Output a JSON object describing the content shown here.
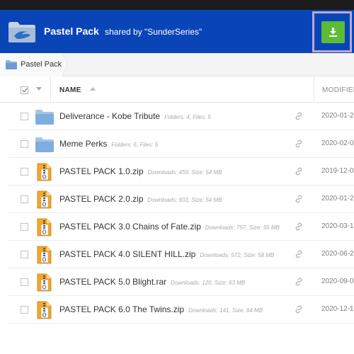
{
  "header": {
    "share_name": "Pastel Pack",
    "shared_by": "shared by \"SunderSeries\"",
    "brand_color": "#0a45b8",
    "download_color": "#5dbb35"
  },
  "breadcrumb": {
    "label": "Pastel Pack"
  },
  "columns": {
    "name": "NAME",
    "modified": "MODIFIED"
  },
  "files": [
    {
      "name": "Deliverance - Kobe Tribute",
      "meta": "Folders: 4, Files: 5",
      "date": "2020-01-2",
      "kind": "folder"
    },
    {
      "name": "Meme Perks",
      "meta": "Folders: 6, Files: 5",
      "date": "2020-02-0",
      "kind": "folder"
    },
    {
      "name": "PASTEL PACK 1.0.zip",
      "meta": "Downloads: 459, Size: 54 MB",
      "date": "2019-12-0",
      "kind": "zip"
    },
    {
      "name": "PASTEL PACK 2.0.zip",
      "meta": "Downloads: 603, Size: 54 MB",
      "date": "2020-01-2",
      "kind": "zip"
    },
    {
      "name": "PASTEL PACK 3.0 Chains of Fate.zip",
      "meta": "Downloads: 757, Size: 55 MB",
      "date": "2020-03-1",
      "kind": "zip"
    },
    {
      "name": "PASTEL PACK 4.0 SILENT HILL.zip",
      "meta": "Downloads: 572, Size: 58 MB",
      "date": "2020-06-2",
      "kind": "zip"
    },
    {
      "name": "PASTEL PACK 5.0 Blight.rar",
      "meta": "Downloads: 120, Size: 63 MB",
      "date": "2020-09-0",
      "kind": "zip"
    },
    {
      "name": "PASTEL PACK 6.0 The Twins.zip",
      "meta": "Downloads: 141, Size: 64 MB",
      "date": "2020-12-1",
      "kind": "zip"
    }
  ]
}
